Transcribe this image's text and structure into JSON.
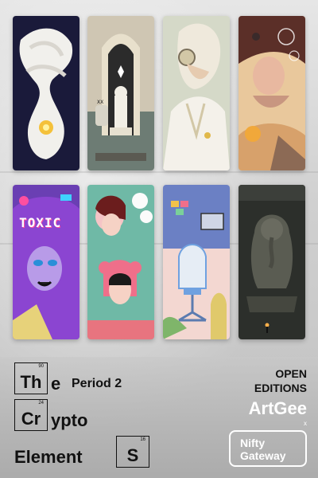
{
  "artworks": [
    {
      "name": "white-sculpture-artwork",
      "bg": "#1a1a3a"
    },
    {
      "name": "chess-arch-artwork",
      "bg": "#cfc6b3"
    },
    {
      "name": "headphones-portrait-artwork",
      "bg": "#cfd5c4"
    },
    {
      "name": "woman-bubbles-artwork",
      "bg": "#e6c49c"
    },
    {
      "name": "toxic-artwork",
      "bg": "#6a3fb3",
      "text": "TOXIC"
    },
    {
      "name": "collage-portraits-artwork",
      "bg": "#6fb9a6"
    },
    {
      "name": "desk-chair-artwork",
      "bg": "#6b80c4"
    },
    {
      "name": "ganesha-statue-artwork",
      "bg": "#2c2f2b"
    }
  ],
  "title": {
    "the_symbol": "Th",
    "the_number": "90",
    "the_rest": "e",
    "period": "Period 2",
    "crypto_symbol": "Cr",
    "crypto_number": "24",
    "crypto_rest": "ypto",
    "element_text": "Element",
    "element_symbol": "S",
    "element_number": "16"
  },
  "branding": {
    "open_line1": "OPEN",
    "open_line2": "EDITIONS",
    "artgee": "ArtGee",
    "artgee_x": "x",
    "nifty_line1": "Nifty",
    "nifty_line2": "Gateway"
  },
  "colors": {
    "text": "#111111",
    "brand_white": "#ffffff"
  }
}
